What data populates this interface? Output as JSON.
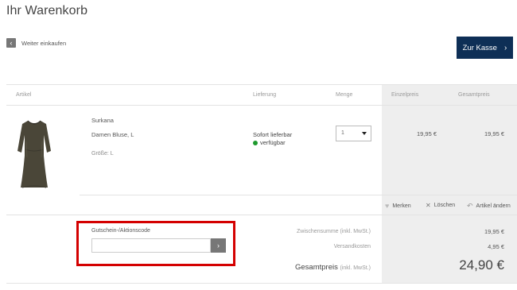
{
  "page": {
    "title": "Ihr Warenkorb"
  },
  "nav": {
    "back_label": "Weiter einkaufen",
    "checkout_label": "Zur Kasse"
  },
  "table": {
    "headers": {
      "article": "Artikel",
      "delivery": "Lieferung",
      "quantity": "Menge",
      "unit_price": "Einzelpreis",
      "total_price": "Gesamtpreis"
    }
  },
  "item": {
    "brand": "Surkana",
    "description": "Damen Bluse, L",
    "size": "Größe: L",
    "delivery_status": "Sofort lieferbar",
    "availability": "verfügbar",
    "quantity": "1",
    "unit_price": "19,95 €",
    "total_price": "19,95 €",
    "actions": {
      "remember": "Merken",
      "delete": "Löschen",
      "change": "Artikel ändern"
    }
  },
  "coupon": {
    "label": "Gutschein-/Aktionscode",
    "value": ""
  },
  "summary": {
    "subtotal_label": "Zwischensumme (inkl. MwSt.)",
    "subtotal_value": "19,95 €",
    "shipping_label": "Versandkosten",
    "shipping_value": "4,95 €",
    "grand_label": "Gesamtpreis",
    "grand_note": "(inkl. MwSt.)",
    "grand_value": "24,90 €"
  },
  "colors": {
    "accent": "#0e2f56",
    "available": "#1e9a2e",
    "highlight": "#d40000"
  }
}
